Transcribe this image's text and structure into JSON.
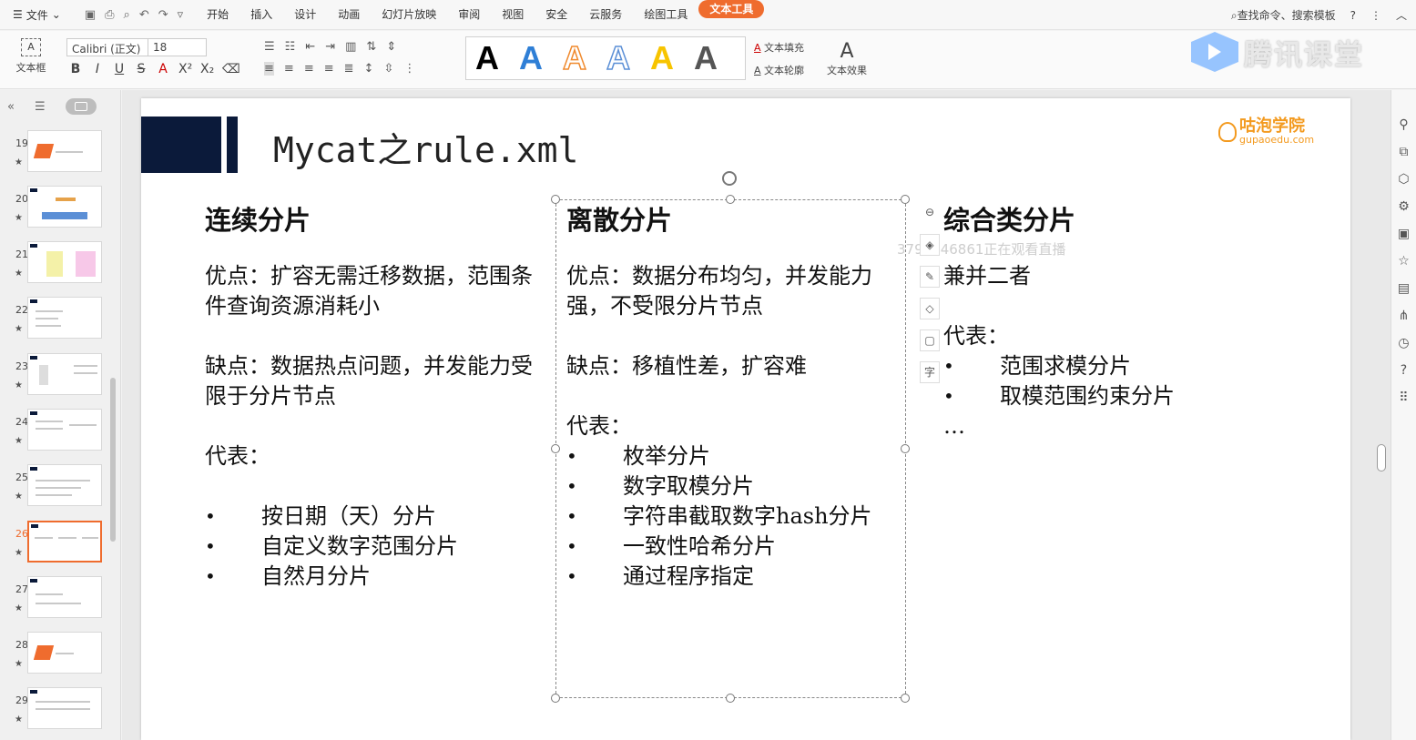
{
  "menu": {
    "file": "文件",
    "tabs": [
      "开始",
      "插入",
      "设计",
      "动画",
      "幻灯片放映",
      "审阅",
      "视图",
      "安全",
      "云服务",
      "绘图工具",
      "文本工具"
    ],
    "active_tab": "文本工具",
    "search": "查找命令、搜索模板"
  },
  "ribbon": {
    "textbox": "文本框",
    "font_name": "Calibri (正文)",
    "font_size": "18",
    "text_fill": "文本填充",
    "text_outline": "文本轮廓",
    "text_effect": "文本效果",
    "style_letter": "A"
  },
  "brand": "腾讯课堂",
  "thumbnails": [
    "19",
    "20",
    "21",
    "22",
    "23",
    "24",
    "25",
    "26",
    "27",
    "28",
    "29"
  ],
  "active_slide": "26",
  "slide": {
    "title": "Mycat之rule.xml",
    "logo_main": "咕泡学院",
    "logo_sub": "gupaoedu.com",
    "col1": {
      "heading": "连续分片",
      "pros": "优点：扩容无需迁移数据，范围条件查询资源消耗小",
      "cons": "缺点：数据热点问题，并发能力受限于分片节点",
      "rep": "代表：",
      "items": [
        "按日期（天）分片",
        "自定义数字范围分片",
        "自然月分片"
      ]
    },
    "col2": {
      "heading": "离散分片",
      "pros": "优点：数据分布均匀，并发能力强，不受限分片节点",
      "cons": "缺点：移植性差，扩容难",
      "rep": "代表：",
      "items": [
        "枚举分片",
        "数字取模分片",
        "字符串截取数字hash分片",
        "一致性哈希分片",
        "通过程序指定"
      ]
    },
    "col3": {
      "heading": "综合类分片",
      "desc": "兼并二者",
      "rep": "代表：",
      "items": [
        "范围求模分片",
        "取模范围约束分片"
      ],
      "more": "…"
    },
    "watermark": "3791746861正在观看直播"
  },
  "colors": {
    "accent": "#ef6c2e",
    "title_block": "#0b1a3a",
    "logo": "#f39a1f"
  }
}
